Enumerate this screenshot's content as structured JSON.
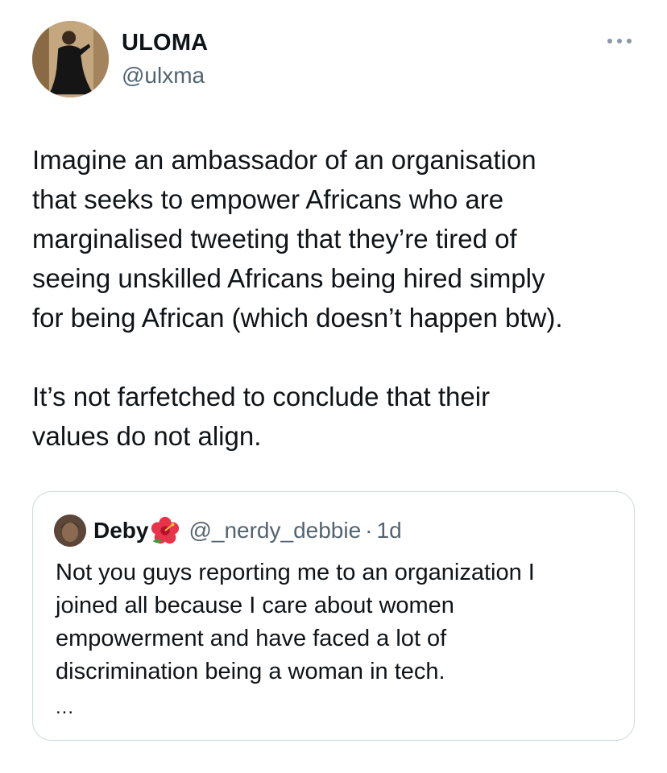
{
  "author": {
    "display_name": "ULOMA",
    "handle": "@ulxma"
  },
  "tweet": {
    "paragraphs": [
      "Imagine an ambassador of an organisation\nthat seeks to empower Africans who are\nmarginalised tweeting that they’re tired of\nseeing unskilled Africans being hired simply\nfor being African (which doesn’t happen btw).",
      "It’s not farfetched to conclude that their\nvalues do not align."
    ]
  },
  "quoted_tweet": {
    "display_name": "Deby",
    "emoji_icon": "hibiscus-icon",
    "handle": "@_nerdy_debbie",
    "separator": "·",
    "time": "1d",
    "text": "Not you guys reporting me to an organization I\njoined all because I care about women\nempowerment and have faced a lot of\ndiscrimination being a woman in tech.",
    "truncation": "..."
  },
  "colors": {
    "text": "#0f1419",
    "secondary_text": "#536471",
    "border": "#cfd9de",
    "more_icon": "#8b98a5"
  }
}
